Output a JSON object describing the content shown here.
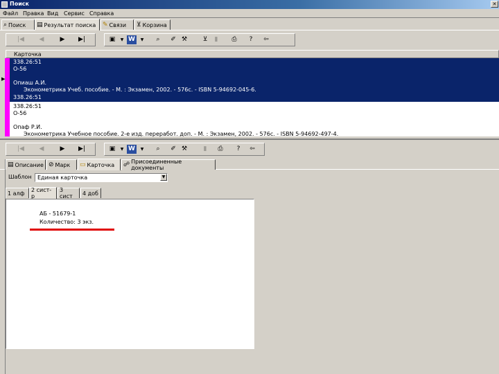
{
  "window": {
    "title": "Поиск",
    "close_glyph": "✕"
  },
  "menu": [
    "Файл",
    "Правка",
    "Вид",
    "Сервис",
    "Справка"
  ],
  "main_tabs": [
    {
      "label": "Поиск",
      "icon": "binoculars-icon"
    },
    {
      "label": "Результат поиска",
      "icon": "document-icon"
    },
    {
      "label": "Связи",
      "icon": "pencil-icon"
    },
    {
      "label": "Корзина",
      "icon": "cart-icon"
    }
  ],
  "grid": {
    "header": "Карточка",
    "records": [
      {
        "lines": [
          "338.26:51",
          "О-56",
          "",
          "Опиаш А.И.",
          "Эконометрика Учеб. пособие. - М. : Экзамен, 2002. - 576с. - ISBN 5-94692-045-6.",
          "338.26:51"
        ],
        "selected": true
      },
      {
        "lines": [
          "338.26:51",
          "О-56",
          "",
          "Опаф Р.И.",
          "Эконометрика Учебное пособие. 2-е изд. переработ. доп. - М. : Экзамен, 2002. - 576с. - ISBN 5-94692-497-4."
        ],
        "selected": false
      }
    ]
  },
  "detail_tabs": [
    {
      "label": "Описание",
      "icon": "doc-icon"
    },
    {
      "label": "Марк",
      "icon": "circle-icon"
    },
    {
      "label": "Карточка",
      "icon": "folder-icon"
    },
    {
      "label": "Присоединенные документы",
      "icon": "link-icon"
    }
  ],
  "template": {
    "label": "Шаблон",
    "value": "Единая карточка"
  },
  "card_tabs": [
    "1 алф",
    "2 сист-р",
    "3 сист",
    "4 доб"
  ],
  "card": {
    "line1": "АБ - 51679-1",
    "line2": "Количество: 3 экз."
  }
}
